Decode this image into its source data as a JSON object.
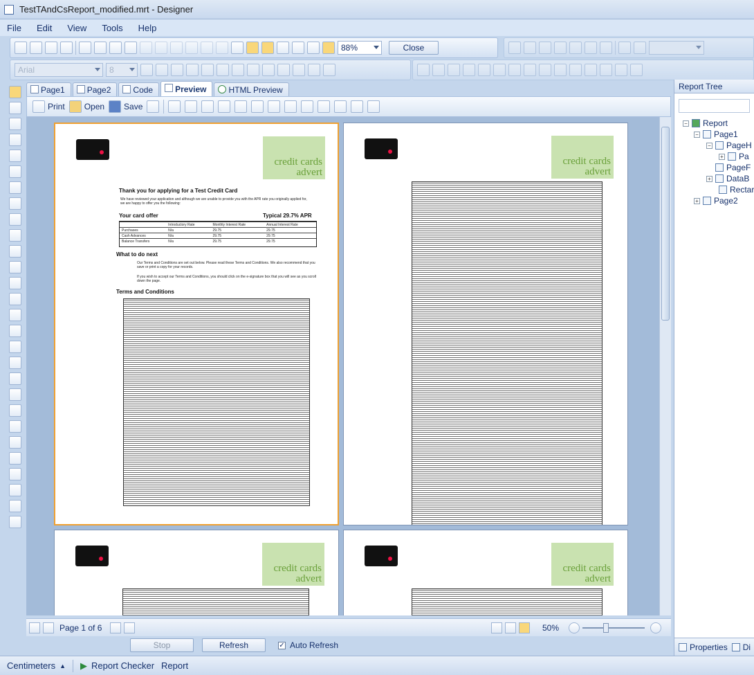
{
  "window": {
    "title": "TestTAndCsReport_modified.mrt - Designer"
  },
  "menu": {
    "items": [
      "File",
      "Edit",
      "View",
      "Tools",
      "Help"
    ]
  },
  "toolbar": {
    "zoom": "88%",
    "close_label": "Close",
    "font_name": "Arial",
    "font_size": "8"
  },
  "tabs": [
    {
      "label": "Page1",
      "icon": "page-icon"
    },
    {
      "label": "Page2",
      "icon": "page-icon"
    },
    {
      "label": "Code",
      "icon": "code-icon"
    },
    {
      "label": "Preview",
      "icon": "preview-icon"
    },
    {
      "label": "HTML Preview",
      "icon": "globe-icon"
    }
  ],
  "preview_toolbar": {
    "print": "Print",
    "open": "Open",
    "save": "Save"
  },
  "page_content": {
    "advert": "credit cards advert",
    "heading": "Thank you for applying for a Test Credit Card",
    "intro": "We have reviewed your application and although we are unable to provide you with the APR rate you originally applied for, we are happy to offer you the following:",
    "offer_title": "Your card offer",
    "offer_apr": "Typical 29.7% APR",
    "offer_cols": [
      "Introductory Rate",
      "Monthly Interest Rate",
      "Annual Interest Rate"
    ],
    "offer_rows": [
      [
        "Purchases",
        "N/a",
        "29.75",
        "29.75"
      ],
      [
        "Cash Advances",
        "N/a",
        "29.75",
        "29.75"
      ],
      [
        "Balance Transfers",
        "N/a",
        "29.75",
        "29.75"
      ]
    ],
    "what_next": "What to do next",
    "what_next_p1": "Our Terms and Conditions are set out below. Please read these Terms and Conditions. We also recommend that you save or print a copy for your records.",
    "what_next_p2": "If you wish to accept our Terms and Conditions, you should click on the e-signature box that you will see as you scroll down the page.",
    "terms": "Terms and Conditions"
  },
  "navigation": {
    "page_info": "Page 1 of 6",
    "zoom": "50%"
  },
  "actions": {
    "stop": "Stop",
    "refresh": "Refresh",
    "auto_refresh": "Auto Refresh",
    "auto_refresh_checked": true
  },
  "statusbar": {
    "units": "Centimeters",
    "checker": "Report Checker",
    "report": "Report"
  },
  "report_tree": {
    "title": "Report Tree",
    "items": [
      "Report",
      "Page1",
      "PageH",
      "Pa",
      "PageF",
      "DataB",
      "Rectar",
      "Page2"
    ]
  },
  "right_tabs": {
    "properties": "Properties",
    "dictionary": "Di"
  }
}
